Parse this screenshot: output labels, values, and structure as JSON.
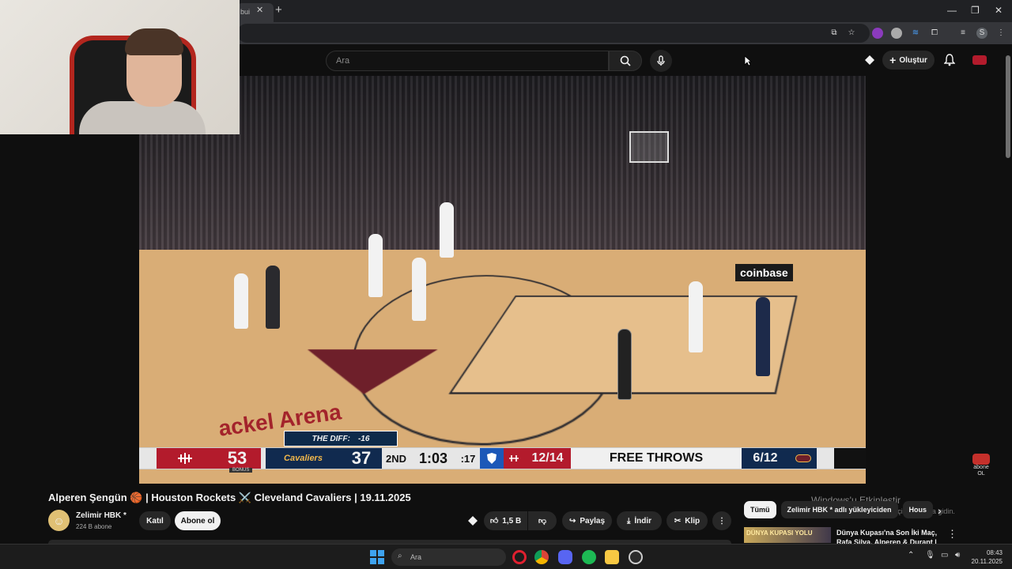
{
  "browser": {
    "tab_label": "bui",
    "tab_close": "✕",
    "new_tab": "+",
    "window_controls": [
      "—",
      "❐",
      "✕"
    ],
    "profile_initial": "S"
  },
  "header": {
    "search_placeholder": "Ara",
    "create_label": "Oluştur",
    "create_plus": "+"
  },
  "video": {
    "scoreboard": {
      "home_score": "53",
      "away_score": "37",
      "diff_label": "THE DIFF:",
      "diff_value": "-16",
      "period": "2ND",
      "clock": "1:03",
      "shot_clock": ":17",
      "home_stat": "12/14",
      "stat_label": "FREE THROWS",
      "away_stat": "6/12",
      "bonus": "BONUS",
      "away_team_logo_text": "Cavaliers"
    },
    "arena_text": "ackel Arena",
    "sponsor": "coinbase",
    "watermark_label": "abone OL"
  },
  "watch": {
    "title": "Alperen Şengün 🏀 | Houston Rockets ⚔️ Cleveland Cavaliers | 19.11.2025",
    "channel_name": "Zelimir HBK *",
    "subscriber_count": "224 B abone",
    "join_label": "Katıl",
    "subscribe_label": "Abone ol",
    "like_count": "1,5 B",
    "share_label": "Paylaş",
    "download_label": "İndir",
    "clip_label": "Klip",
    "more_label": "⋮"
  },
  "sidebar": {
    "chips": [
      "Tümü",
      "Zelimir HBK * adlı yükleyiciden",
      "Hous"
    ],
    "activation_title": "Windows'u Etkinleştir",
    "activation_sub": "Windows'u etkinleştirmek için Ayarlar'a gidin.",
    "rec_thumb_text": "DÜNYA KUPASI YOLU",
    "rec_title": "Dünya Kupası'na Son İki Maç, Rafa Silva, Alperen & Durant |"
  },
  "taskbar": {
    "search_label": "Ara",
    "time": "08:43",
    "date": "20.11.2025"
  },
  "colors": {
    "rockets_red": "#b31b2c",
    "cavs_navy": "#102a4f",
    "cavs_wine": "#6e1f2a",
    "yt_bg": "#0f0f0f"
  }
}
